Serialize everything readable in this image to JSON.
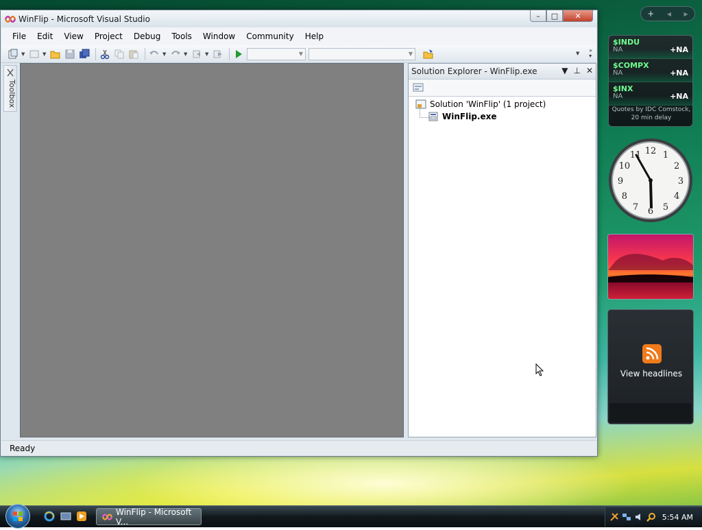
{
  "window": {
    "title": "WinFlip - Microsoft Visual Studio",
    "controls": {
      "minimize": "–",
      "maximize": "□",
      "close": "✕"
    }
  },
  "menu": [
    "File",
    "Edit",
    "View",
    "Project",
    "Debug",
    "Tools",
    "Window",
    "Community",
    "Help"
  ],
  "toolbox": {
    "label": "Toolbox"
  },
  "solution_explorer": {
    "title": "Solution Explorer - WinFlip.exe",
    "tree": {
      "solution": "Solution 'WinFlip' (1 project)",
      "project": "WinFlip.exe"
    }
  },
  "status": {
    "text": "Ready"
  },
  "sidebar": {
    "controls": {
      "add": "+",
      "prev": "◀",
      "next": "▶"
    },
    "stocks": [
      {
        "symbol": "$INDU",
        "value": "NA",
        "change": "+NA"
      },
      {
        "symbol": "$COMPX",
        "value": "NA",
        "change": "+NA"
      },
      {
        "symbol": "$INX",
        "value": "NA",
        "change": "+NA"
      }
    ],
    "stocks_note": "Quotes by IDC Comstock, 20 min delay",
    "feeds_label": "View headlines"
  },
  "clock_face": {
    "numerals": [
      "12",
      "1",
      "2",
      "3",
      "4",
      "5",
      "6",
      "7",
      "8",
      "9",
      "10",
      "11"
    ]
  },
  "taskbar": {
    "task_label": "WinFlip - Microsoft V...",
    "time": "5:54 AM"
  }
}
